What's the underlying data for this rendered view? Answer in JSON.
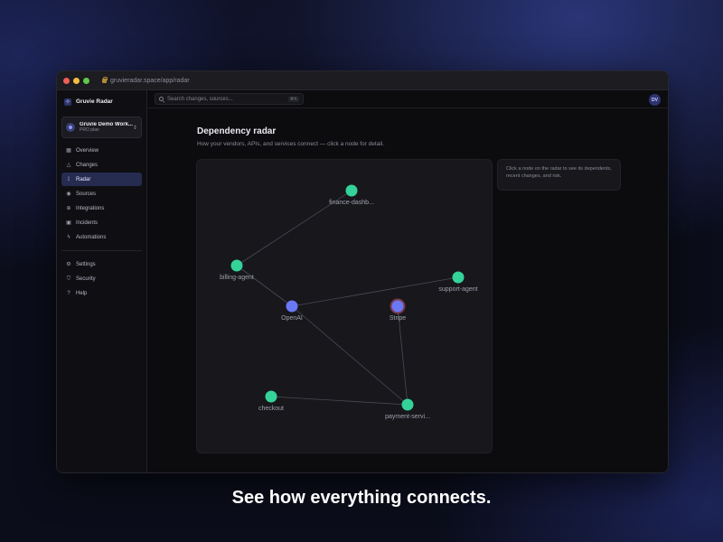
{
  "browser": {
    "url": "gruvieradar.space/app/radar"
  },
  "sidebar": {
    "brand": "Gruvie Radar",
    "workspace": {
      "name": "Gruvie Demo Work...",
      "plan": "PRO plan"
    },
    "items": [
      {
        "label": "Overview",
        "icon": "grid-icon"
      },
      {
        "label": "Changes",
        "icon": "warning-icon"
      },
      {
        "label": "Radar",
        "icon": "radar-icon",
        "active": true
      },
      {
        "label": "Sources",
        "icon": "broadcast-icon"
      },
      {
        "label": "Integrations",
        "icon": "plug-icon"
      },
      {
        "label": "Incidents",
        "icon": "alarm-icon"
      },
      {
        "label": "Automations",
        "icon": "bolt-icon"
      }
    ],
    "bottom_items": [
      {
        "label": "Settings",
        "icon": "gear-icon"
      },
      {
        "label": "Security",
        "icon": "shield-icon"
      },
      {
        "label": "Help",
        "icon": "help-icon"
      }
    ]
  },
  "topbar": {
    "search_placeholder": "Search changes, sources...",
    "shortcut": "⌘K",
    "avatar_initials": "DV"
  },
  "page": {
    "title": "Dependency radar",
    "subtitle": "How your vendors, APIs, and services connect — click a node for detail.",
    "detail_hint": "Click a node on the radar to see its dependents, recent changes, and risk."
  },
  "graph": {
    "colors": {
      "service": "#34d399",
      "vendor": "#6b78f5",
      "vendor_ring": "#7a3a4a",
      "edge": "#4a4b55"
    },
    "nodes": [
      {
        "id": "finance-dashb",
        "label": "finance-dashb...",
        "kind": "service"
      },
      {
        "id": "billing-agent",
        "label": "billing-agent",
        "kind": "service"
      },
      {
        "id": "support-agent",
        "label": "support-agent",
        "kind": "service"
      },
      {
        "id": "openai",
        "label": "OpenAI",
        "kind": "vendor"
      },
      {
        "id": "stripe",
        "label": "Stripe",
        "kind": "vendor",
        "highlight": true
      },
      {
        "id": "checkout",
        "label": "checkout",
        "kind": "service"
      },
      {
        "id": "payment-servi",
        "label": "payment-servi...",
        "kind": "service"
      }
    ],
    "edges": [
      [
        "finance-dashb",
        "billing-agent"
      ],
      [
        "billing-agent",
        "openai"
      ],
      [
        "support-agent",
        "openai"
      ],
      [
        "openai",
        "payment-servi"
      ],
      [
        "stripe",
        "payment-servi"
      ],
      [
        "checkout",
        "payment-servi"
      ]
    ]
  },
  "caption": "See how everything connects."
}
